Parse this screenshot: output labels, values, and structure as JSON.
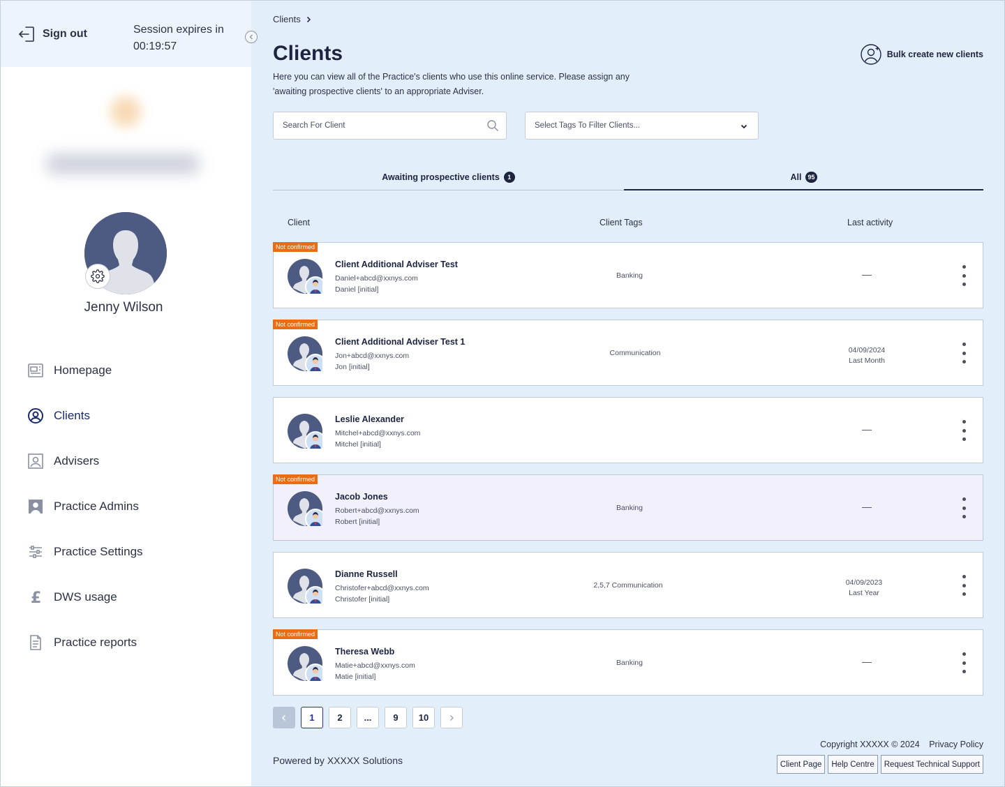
{
  "sidebar": {
    "signout_label": "Sign out",
    "session_text": "Session expires in",
    "session_timer": "00:19:57",
    "user_name": "Jenny Wilson",
    "nav": [
      {
        "label": "Homepage",
        "icon": "newspaper-icon"
      },
      {
        "label": "Clients",
        "icon": "user-circle-icon",
        "active": true
      },
      {
        "label": "Advisers",
        "icon": "portrait-icon"
      },
      {
        "label": "Practice Admins",
        "icon": "admin-portrait-icon"
      },
      {
        "label": "Practice Settings",
        "icon": "sliders-icon"
      },
      {
        "label": "DWS usage",
        "icon": "pound-icon"
      },
      {
        "label": "Practice reports",
        "icon": "document-icon"
      }
    ]
  },
  "main": {
    "breadcrumb": "Clients",
    "title": "Clients",
    "description": "Here you can view all of the Practice's clients who use this online service. Please assign any 'awaiting prospective clients' to an appropriate Adviser.",
    "bulk_label": "Bulk create new clients",
    "search_placeholder": "Search For Client",
    "tags_placeholder": "Select Tags To Filter Clients...",
    "tabs": [
      {
        "label": "Awaiting prospective clients",
        "count": "1"
      },
      {
        "label": "All",
        "count": "95"
      }
    ],
    "columns": {
      "client": "Client",
      "tags": "Client Tags",
      "activity": "Last activity"
    },
    "rows": [
      {
        "badge": "Not confirmed",
        "name": "Client Additional Adviser Test",
        "email": "Daniel+abcd@xxnys.com",
        "sub": "Daniel [initial]",
        "tags": "Banking",
        "date": "",
        "relative": "",
        "dash": "—"
      },
      {
        "badge": "Not confirmed",
        "name": "Client Additional Adviser Test 1",
        "email": "Jon+abcd@xxnys.com",
        "sub": "Jon [initial]",
        "tags": "Communication",
        "date": "04/09/2024",
        "relative": "Last Month",
        "dash": ""
      },
      {
        "badge": "",
        "name": "Leslie Alexander",
        "email": "Mitchel+abcd@xxnys.com",
        "sub": "Mitchel [initial]",
        "tags": "",
        "date": "",
        "relative": "",
        "dash": "—"
      },
      {
        "badge": "Not confirmed",
        "name": "Jacob Jones",
        "email": "Robert+abcd@xxnys.com",
        "sub": "Robert [initial]",
        "tags": "Banking",
        "date": "",
        "relative": "",
        "dash": "—"
      },
      {
        "badge": "",
        "name": "Dianne Russell",
        "email": "Christofer+abcd@xxnys.com",
        "sub": "Christofer [initial]",
        "tags": "2,5,7 Communication",
        "date": "04/09/2023",
        "relative": "Last Year",
        "dash": ""
      },
      {
        "badge": "Not confirmed",
        "name": "Theresa Webb",
        "email": "Matie+abcd@xxnys.com",
        "sub": "Matie [initial]",
        "tags": "Banking",
        "date": "",
        "relative": "",
        "dash": "—"
      }
    ],
    "pagination": [
      "1",
      "2",
      "...",
      "9",
      "10"
    ],
    "current_page": "1"
  },
  "footer": {
    "powered": "Powered by XXXXX Solutions",
    "copyright": "Copyright XXXXX © 2024",
    "privacy": "Privacy Policy",
    "links": [
      "Client Page",
      "Help Centre",
      "Request Technical Support"
    ]
  },
  "colors": {
    "accent": "#1c2440",
    "badge": "#e96d14",
    "background": "#e3eefb",
    "avatar": "#4d5a82"
  }
}
